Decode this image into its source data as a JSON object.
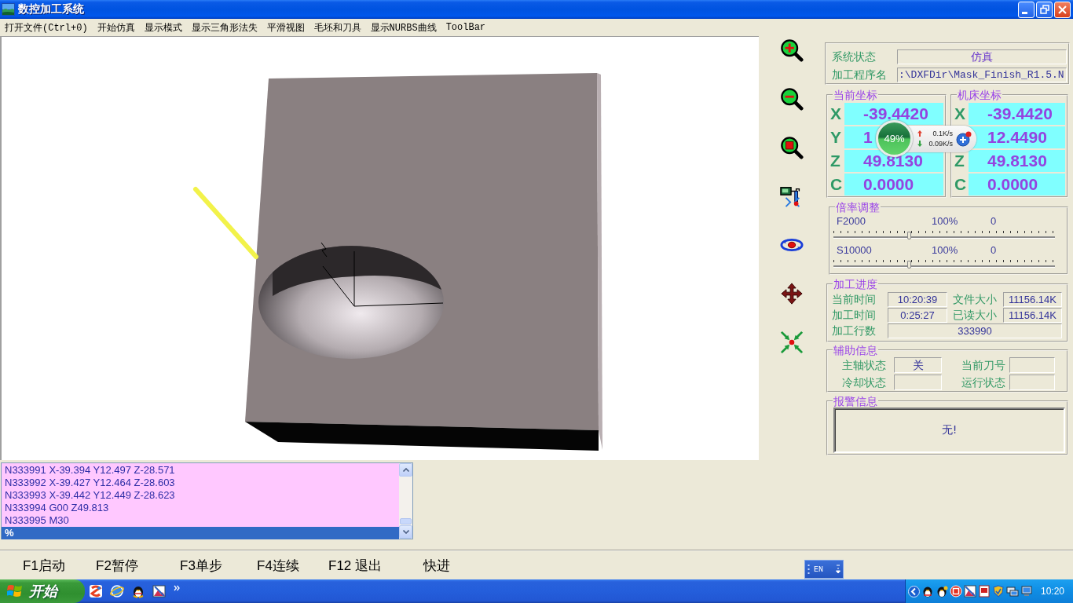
{
  "window": {
    "title": "数控加工系统"
  },
  "menu": [
    "打开文件(Ctrl+0)",
    "开始仿真",
    "显示模式",
    "显示三角形法失",
    "平滑视图",
    "毛坯和刀具",
    "显示NURBS曲线",
    "ToolBar"
  ],
  "status": [
    {
      "kind": "status",
      "label": "系统状态",
      "value": "仿真"
    },
    {
      "kind": "path",
      "label": "加工程序名",
      "value": ":\\DXFDir\\Mask_Finish_R1.5.N"
    }
  ],
  "current_coords": {
    "title": "当前坐标",
    "axes": [
      {
        "axis": "X",
        "value": "-39.4420"
      },
      {
        "axis": "Y",
        "value": "1"
      },
      {
        "axis": "Z",
        "value": "49.8130"
      },
      {
        "axis": "C",
        "value": "0.0000"
      }
    ]
  },
  "machine_coords": {
    "title": "机床坐标",
    "axes": [
      {
        "axis": "X",
        "value": "-39.4420"
      },
      {
        "value": "12.4490"
      },
      {
        "axis": "Z",
        "value": "49.8130"
      },
      {
        "axis": "C",
        "value": "0.0000"
      }
    ]
  },
  "speed_widget": {
    "percent": "49%",
    "upload": "0.1K/s",
    "download": "0.09K/s"
  },
  "rate_adjust": {
    "title": "倍率调整",
    "sliders": [
      {
        "name": "F2000",
        "percent": "100%",
        "value": "0",
        "level": 0.34
      },
      {
        "name": "S10000",
        "percent": "100%",
        "value": "0",
        "level": 0.34
      }
    ]
  },
  "progress": {
    "title": "加工进度",
    "items": [
      {
        "label": "当前时间",
        "value": "10:20:39"
      },
      {
        "label": "文件大小",
        "value": "11156.14K"
      },
      {
        "label": "加工时间",
        "value": "0:25:27"
      },
      {
        "label": "已读大小",
        "value": "11156.14K"
      },
      {
        "label": "加工行数",
        "value": "333990"
      }
    ]
  },
  "aux": {
    "title": "辅助信息",
    "fields": [
      {
        "label": "主轴状态",
        "value": "关"
      },
      {
        "label": "当前刀号"
      },
      {
        "label": "冷却状态"
      },
      {
        "label": "运行状态"
      }
    ]
  },
  "alarm": {
    "title": "报警信息",
    "message": "无!"
  },
  "gcode": {
    "lines": [
      {
        "text": "N333991 X-39.394 Y12.497 Z-28.571",
        "selected": false
      },
      {
        "text": "N333992 X-39.427 Y12.464 Z-28.603",
        "selected": false
      },
      {
        "text": "N333993 X-39.442 Y12.449 Z-28.623",
        "selected": false
      },
      {
        "text": "N333994 G00 Z49.813",
        "selected": false
      },
      {
        "text": "N333995 M30",
        "selected": false
      },
      {
        "text": "%",
        "selected": true
      }
    ]
  },
  "function_keys": [
    "F1启动",
    "F2暂停",
    "F3单步",
    "F4连续",
    "F12 退出",
    "快进"
  ],
  "language_bar": {
    "label": "EN"
  },
  "taskbar": {
    "start": "开始",
    "clock": "10:20"
  }
}
